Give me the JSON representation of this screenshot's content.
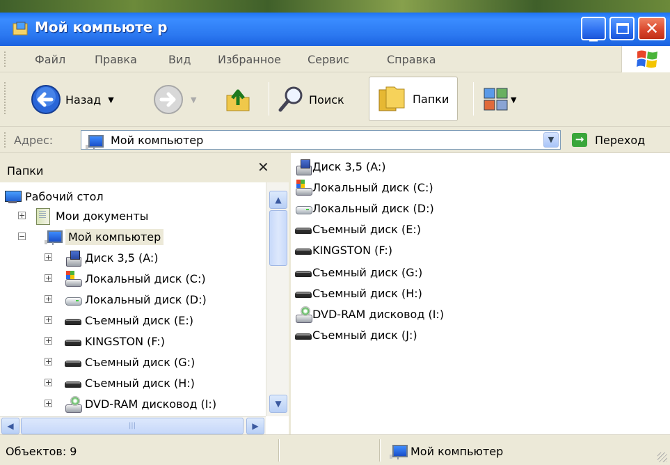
{
  "window": {
    "title": "Мой компьюте р"
  },
  "menu": [
    "Файл",
    "Правка",
    "Вид",
    "Избранное",
    "Сервис",
    "Справка"
  ],
  "toolbar": {
    "back": "Назад",
    "search": "Поиск",
    "folders": "Папки"
  },
  "address": {
    "label": "Адрес:",
    "value": "Мой компьютер",
    "go": "Переход"
  },
  "folders_pane": {
    "title": "Папки",
    "tree": [
      {
        "label": "Рабочий стол",
        "icon": "desktop-icon"
      },
      {
        "label": "Мои документы",
        "icon": "my-documents-icon"
      },
      {
        "label": "Мой компьютер",
        "icon": "my-computer-icon"
      },
      {
        "label": "Диск 3,5 (A:)",
        "icon": "floppy-drive-icon"
      },
      {
        "label": "Локальный диск (C:)",
        "icon": "system-disk-icon"
      },
      {
        "label": "Локальный диск (D:)",
        "icon": "hard-disk-icon"
      },
      {
        "label": "Съемный диск (E:)",
        "icon": "removable-disk-icon"
      },
      {
        "label": "KINGSTON (F:)",
        "icon": "removable-disk-icon"
      },
      {
        "label": "Съемный диск (G:)",
        "icon": "removable-disk-icon"
      },
      {
        "label": "Съемный диск (H:)",
        "icon": "removable-disk-icon"
      },
      {
        "label": "DVD-RAM дисковод (I:)",
        "icon": "dvd-drive-icon"
      }
    ]
  },
  "content_items": [
    {
      "label": "Диск 3,5 (A:)",
      "icon": "floppy-drive-icon"
    },
    {
      "label": "Локальный диск (C:)",
      "icon": "system-disk-icon"
    },
    {
      "label": "Локальный диск (D:)",
      "icon": "hard-disk-icon"
    },
    {
      "label": "Съемный диск (E:)",
      "icon": "removable-disk-icon"
    },
    {
      "label": "KINGSTON (F:)",
      "icon": "removable-disk-icon"
    },
    {
      "label": "Съемный диск (G:)",
      "icon": "removable-disk-icon"
    },
    {
      "label": "Съемный диск (H:)",
      "icon": "removable-disk-icon"
    },
    {
      "label": "DVD-RAM дисковод (I:)",
      "icon": "dvd-drive-icon"
    },
    {
      "label": "Съемный диск (J:)",
      "icon": "removable-disk-icon"
    }
  ],
  "status": {
    "objects": "Объектов: 9",
    "location": "Мой компьютер"
  },
  "colors": {
    "titlebar": "#2b78f0",
    "chrome": "#ece9d8",
    "close": "#d8452a"
  }
}
